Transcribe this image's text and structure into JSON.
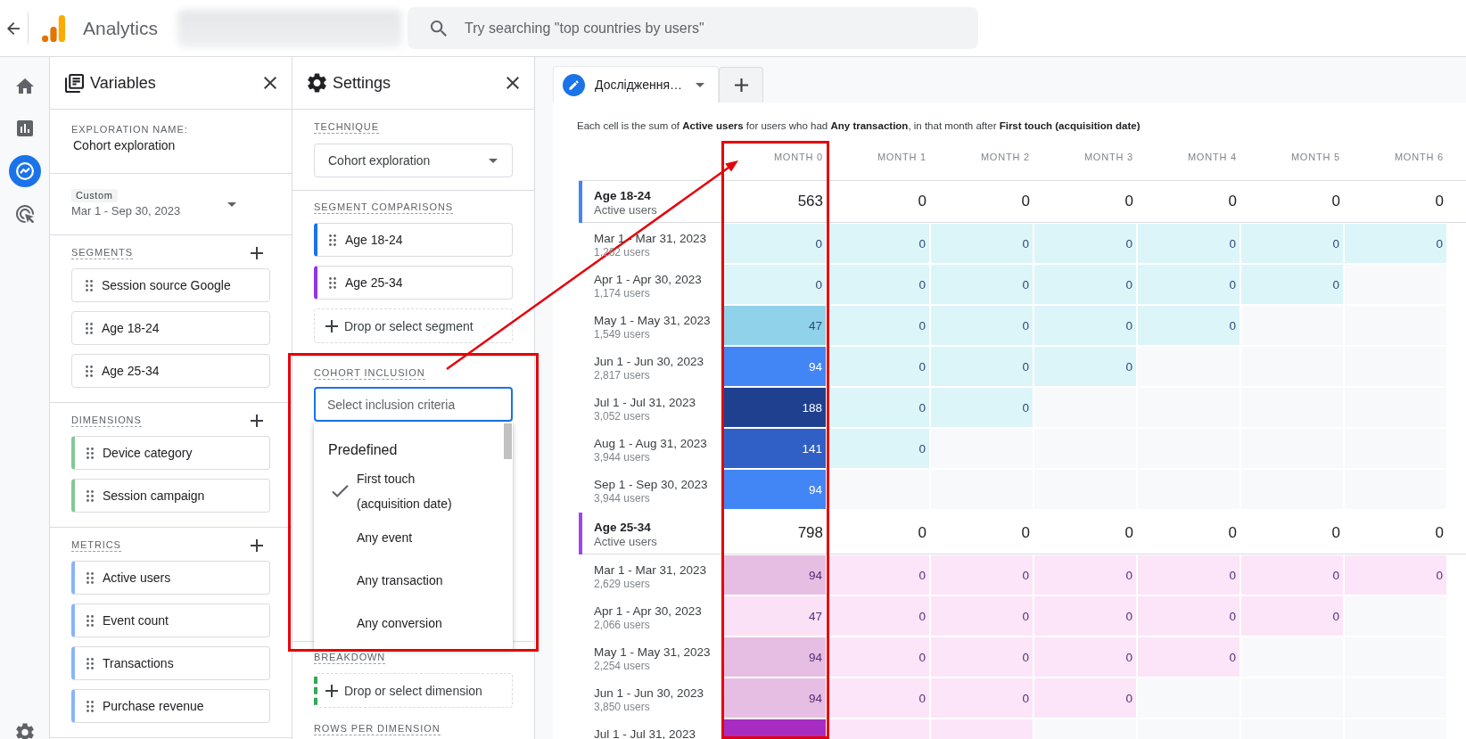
{
  "top_bar": {
    "title": "Analytics",
    "search": {
      "placeholder": "Try searching \"top countries by users\""
    }
  },
  "nav_rail": {
    "items": [
      {
        "kind": "home",
        "selected": false
      },
      {
        "kind": "reports",
        "selected": false
      },
      {
        "kind": "explore",
        "selected": true
      },
      {
        "kind": "advertising",
        "selected": false
      }
    ],
    "footer": [
      {
        "kind": "admin",
        "selected": false
      }
    ]
  },
  "variables_panel": {
    "title": "Variables",
    "exploration_name": {
      "label": "EXPLORATION NAME:",
      "value": "Cohort exploration"
    },
    "date_range": {
      "preset": "Custom",
      "value": "Mar 1 - Sep 30, 2023"
    },
    "sections": [
      {
        "kind": "segment",
        "title": "SEGMENTS",
        "items": [
          "Session source Google",
          "Age 18-24",
          "Age 25-34"
        ]
      },
      {
        "kind": "dimension",
        "title": "DIMENSIONS",
        "items": [
          "Device category",
          "Session campaign"
        ]
      },
      {
        "kind": "metric",
        "title": "METRICS",
        "items": [
          "Active users",
          "Event count",
          "Transactions",
          "Purchase revenue"
        ]
      }
    ]
  },
  "settings_panel": {
    "title": "Settings",
    "technique": {
      "label": "TECHNIQUE",
      "value": "Cohort exploration"
    },
    "segment_comparisons": {
      "label": "SEGMENT COMPARISONS",
      "items": [
        {
          "name": "Age 18-24",
          "color": "#1a73e8"
        },
        {
          "name": "Age 25-34",
          "color": "#9334e6"
        }
      ],
      "drop_zone": "Drop or select segment"
    },
    "cohort_inclusion": {
      "label": "COHORT INCLUSION",
      "placeholder": "Select inclusion criteria",
      "menu": {
        "group": "Predefined",
        "options": [
          {
            "label": "First touch (acquisition date)",
            "selected": true
          },
          {
            "label": "Any event",
            "selected": false
          },
          {
            "label": "Any transaction",
            "selected": false
          },
          {
            "label": "Any conversion",
            "selected": false
          }
        ]
      }
    },
    "breakdown": {
      "label": "BREAKDOWN",
      "drop_zone": "Drop or select dimension"
    },
    "rows_per_dimension": {
      "label": "ROWS PER DIMENSION"
    }
  },
  "exploration": {
    "tabs": [
      {
        "label": "Дослідження…",
        "selected": true
      }
    ],
    "description": "Each cell is the sum of **Active users** for users who had **Any transaction**, in that month after **First touch (acquisition date)**",
    "table": {
      "columns": [
        "MONTH 0",
        "MONTH 1",
        "MONTH 2",
        "MONTH 3",
        "MONTH 4",
        "MONTH 5",
        "MONTH 6"
      ],
      "groups": [
        {
          "name": "Age 18-24",
          "metric": "Active users",
          "color": "#4285f4",
          "totals": [
            "563",
            "0",
            "0",
            "0",
            "0",
            "0",
            "0"
          ],
          "rows": [
            {
              "label": "Mar 1 - Mar 31, 2023",
              "users": "1,262 users",
              "cells": [
                {
                  "value": "0",
                  "color": "#dcf5f9"
                },
                {
                  "value": "0",
                  "color": "#dcf5f9"
                },
                {
                  "value": "0",
                  "color": "#dcf5f9"
                },
                {
                  "value": "0",
                  "color": "#dcf5f9"
                },
                {
                  "value": "0",
                  "color": "#dcf5f9"
                },
                {
                  "value": "0",
                  "color": "#dcf5f9"
                },
                {
                  "value": "0",
                  "color": "#dcf5f9"
                }
              ]
            },
            {
              "label": "Apr 1 - Apr 30, 2023",
              "users": "1,174 users",
              "cells": [
                {
                  "value": "0",
                  "color": "#dcf5f9"
                },
                {
                  "value": "0",
                  "color": "#dcf5f9"
                },
                {
                  "value": "0",
                  "color": "#dcf5f9"
                },
                {
                  "value": "0",
                  "color": "#dcf5f9"
                },
                {
                  "value": "0",
                  "color": "#dcf5f9"
                },
                {
                  "value": "0",
                  "color": "#dcf5f9"
                }
              ]
            },
            {
              "label": "May 1 - May 31, 2023",
              "users": "1,549 users",
              "cells": [
                {
                  "value": "47",
                  "color": "#90d2ea"
                },
                {
                  "value": "0",
                  "color": "#dcf5f9"
                },
                {
                  "value": "0",
                  "color": "#dcf5f9"
                },
                {
                  "value": "0",
                  "color": "#dcf5f9"
                },
                {
                  "value": "0",
                  "color": "#dcf5f9"
                }
              ]
            },
            {
              "label": "Jun 1 - Jun 30, 2023",
              "users": "2,817 users",
              "cells": [
                {
                  "value": "94",
                  "color": "#4285f4"
                },
                {
                  "value": "0",
                  "color": "#dcf5f9"
                },
                {
                  "value": "0",
                  "color": "#dcf5f9"
                },
                {
                  "value": "0",
                  "color": "#dcf5f9"
                }
              ]
            },
            {
              "label": "Jul 1 - Jul 31, 2023",
              "users": "3,052 users",
              "cells": [
                {
                  "value": "188",
                  "color": "#1f3f8f"
                },
                {
                  "value": "0",
                  "color": "#dcf5f9"
                },
                {
                  "value": "0",
                  "color": "#dcf5f9"
                }
              ]
            },
            {
              "label": "Aug 1 - Aug 31, 2023",
              "users": "3,944 users",
              "cells": [
                {
                  "value": "141",
                  "color": "#3060c6"
                },
                {
                  "value": "0",
                  "color": "#dcf5f9"
                }
              ]
            },
            {
              "label": "Sep 1 - Sep 30, 2023",
              "users": "3,944 users",
              "cells": [
                {
                  "value": "94",
                  "color": "#4285f4"
                }
              ]
            }
          ]
        },
        {
          "name": "Age 25-34",
          "metric": "Active users",
          "color": "#a142f4",
          "totals": [
            "798",
            "0",
            "0",
            "0",
            "0",
            "0",
            "0"
          ],
          "rows": [
            {
              "label": "Mar 1 - Mar 31, 2023",
              "users": "2,629 users",
              "cells": [
                {
                  "value": "94",
                  "color": "#e6bee3"
                },
                {
                  "value": "0",
                  "color": "#fce5f8"
                },
                {
                  "value": "0",
                  "color": "#fce5f8"
                },
                {
                  "value": "0",
                  "color": "#fce5f8"
                },
                {
                  "value": "0",
                  "color": "#fce5f8"
                },
                {
                  "value": "0",
                  "color": "#fce5f8"
                },
                {
                  "value": "0",
                  "color": "#fce5f8"
                }
              ]
            },
            {
              "label": "Apr 1 - Apr 30, 2023",
              "users": "2,066 users",
              "cells": [
                {
                  "value": "47",
                  "color": "#fae1f6"
                },
                {
                  "value": "0",
                  "color": "#fce5f8"
                },
                {
                  "value": "0",
                  "color": "#fce5f8"
                },
                {
                  "value": "0",
                  "color": "#fce5f8"
                },
                {
                  "value": "0",
                  "color": "#fce5f8"
                },
                {
                  "value": "0",
                  "color": "#fce5f8"
                }
              ]
            },
            {
              "label": "May 1 - May 31, 2023",
              "users": "2,254 users",
              "cells": [
                {
                  "value": "94",
                  "color": "#e6bee3"
                },
                {
                  "value": "0",
                  "color": "#fce5f8"
                },
                {
                  "value": "0",
                  "color": "#fce5f8"
                },
                {
                  "value": "0",
                  "color": "#fce5f8"
                },
                {
                  "value": "0",
                  "color": "#fce5f8"
                }
              ]
            },
            {
              "label": "Jun 1 - Jun 30, 2023",
              "users": "3,850 users",
              "cells": [
                {
                  "value": "94",
                  "color": "#e6bee3"
                },
                {
                  "value": "0",
                  "color": "#fce5f8"
                },
                {
                  "value": "0",
                  "color": "#fce5f8"
                },
                {
                  "value": "0",
                  "color": "#fce5f8"
                }
              ]
            },
            {
              "label": "Jul 1 - Jul 31, 2023",
              "cells": [
                {
                  "color": "#a62cc2"
                },
                {
                  "color": "#fce5f8"
                },
                {
                  "color": "#fce5f8"
                }
              ]
            }
          ]
        }
      ]
    }
  }
}
